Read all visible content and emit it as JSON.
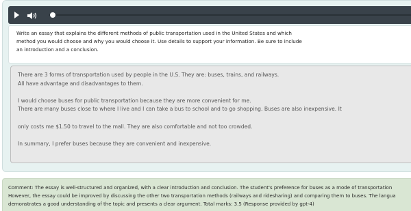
{
  "player": {
    "play_icon": "play-icon",
    "volume_icon": "volume-icon"
  },
  "prompt": {
    "text": "Write an essay that explains the different methods of public transportation used in the United States and which\nmethod you would choose and why you would choose it. Use details to support your information. Be sure to include\nan introduction and a conclusion."
  },
  "essay": {
    "text": "There are 3 forms of transportation used by people in the U.S. They are: buses, trains, and railways.\nAll have advantage and disadvantages to them.\n\nI would choose buses for public transportation because they are more convenient for me.\nThere are many buses close to where I live and I can take a bus to school and to go shopping. Buses are also inexpensive. It\n\nonly costs me $1.50 to travel to the mall. They are also comfortable and not too crowded.\n\nIn summary, I prefer buses because they are convenient and inexpensive."
  },
  "comment": {
    "text": "Comment: The essay is well-structured and organized, with a clear introduction and conclusion. The student's preference for buses as a mode of transportation\nHowever, the essay could be improved by discussing the other two transportation methods (railways and ridesharing) and comparing them to buses. The langua\ndemonstrates a good understanding of the topic and presents a clear argument. Total marks: 3.5 (Response provided by gpt-4)"
  },
  "colors": {
    "panel_bg": "#e7f2f1",
    "player_bg": "#39424a",
    "essay_bg": "#e8e8e8",
    "comment_bg": "#d9e6d3"
  }
}
